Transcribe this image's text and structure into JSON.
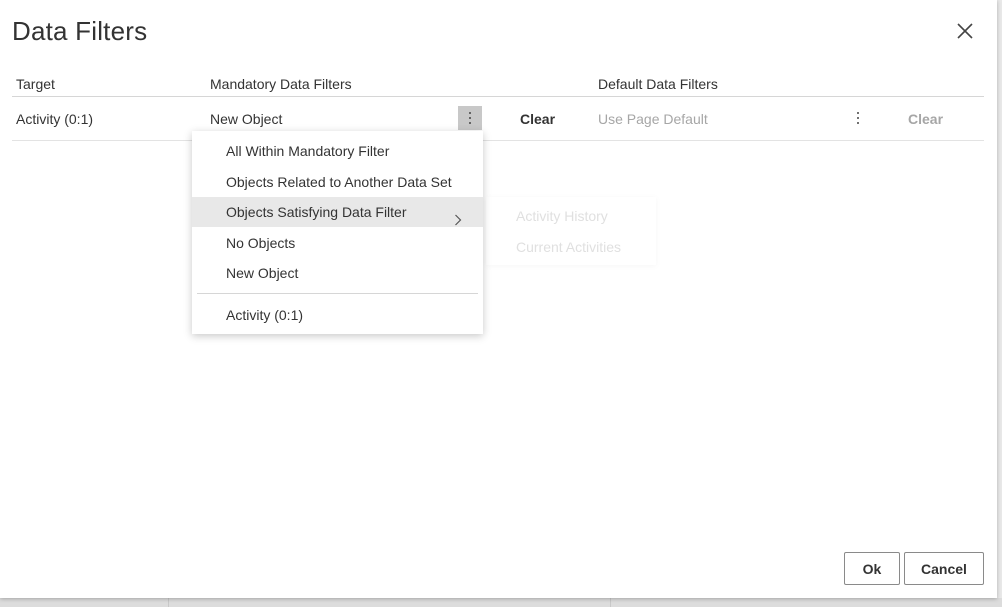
{
  "dialog": {
    "title": "Data Filters",
    "close_icon": "close-icon"
  },
  "table": {
    "headers": {
      "target": "Target",
      "mandatory": "Mandatory Data Filters",
      "default": "Default Data Filters"
    },
    "rows": [
      {
        "target": "Activity (0:1)",
        "mandatory_value": "New Object",
        "mandatory_clear": "Clear",
        "default_value": "Use Page Default",
        "default_clear": "Clear"
      }
    ]
  },
  "menu": {
    "items": [
      {
        "label": "All Within Mandatory Filter"
      },
      {
        "label": "Objects Related to Another Data Set"
      },
      {
        "label": "Objects Satisfying Data Filter",
        "has_submenu": true,
        "highlighted": true
      },
      {
        "label": "No Objects"
      },
      {
        "label": "New Object"
      },
      {
        "label": "Activity (0:1)"
      }
    ]
  },
  "submenu": {
    "items": [
      {
        "label": "Activity History"
      },
      {
        "label": "Current Activities"
      }
    ]
  },
  "footer": {
    "ok_label": "Ok",
    "cancel_label": "Cancel"
  },
  "colors": {
    "text": "#333333",
    "muted_text": "#a6a6a6",
    "hover_bg": "#e8e8e8",
    "active_kebab_bg": "#c8c8c8",
    "button_border": "#8a8a8a"
  }
}
